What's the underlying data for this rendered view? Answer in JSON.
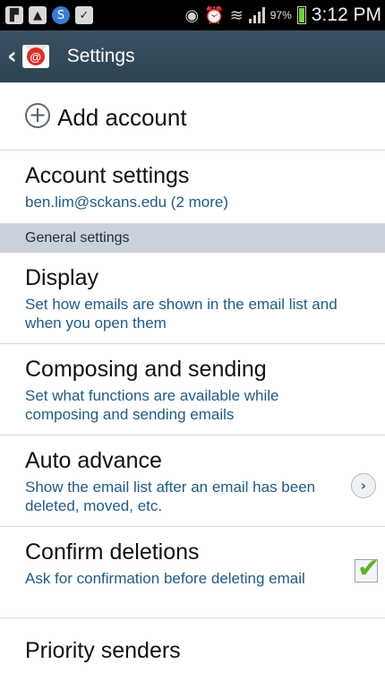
{
  "status_bar": {
    "notification_icons": [
      "flipboard-icon",
      "gallery-icon",
      "app-icon",
      "clipboard-check-icon"
    ],
    "battery_percent": "97%",
    "time": "3:12 PM"
  },
  "action_bar": {
    "title": "Settings"
  },
  "add_account": {
    "label": "Add account"
  },
  "account_settings": {
    "title": "Account settings",
    "subtitle": "ben.lim@sckans.edu (2 more)"
  },
  "general_header": "General settings",
  "display": {
    "title": "Display",
    "subtitle": "Set how emails are shown in the email list and when you open them"
  },
  "composing": {
    "title": "Composing and sending",
    "subtitle": "Set what functions are available while composing and sending emails"
  },
  "auto_advance": {
    "title": "Auto advance",
    "subtitle": "Show the email list after an email has been deleted, moved, etc."
  },
  "confirm_deletions": {
    "title": "Confirm deletions",
    "subtitle": "Ask for confirmation before deleting email",
    "checked": true
  },
  "priority_senders": {
    "title": "Priority senders"
  },
  "colors": {
    "action_bar": "#34495a",
    "section_header": "#c9d2dc",
    "subtitle_text": "#215b84",
    "check_green": "#5db52d"
  }
}
